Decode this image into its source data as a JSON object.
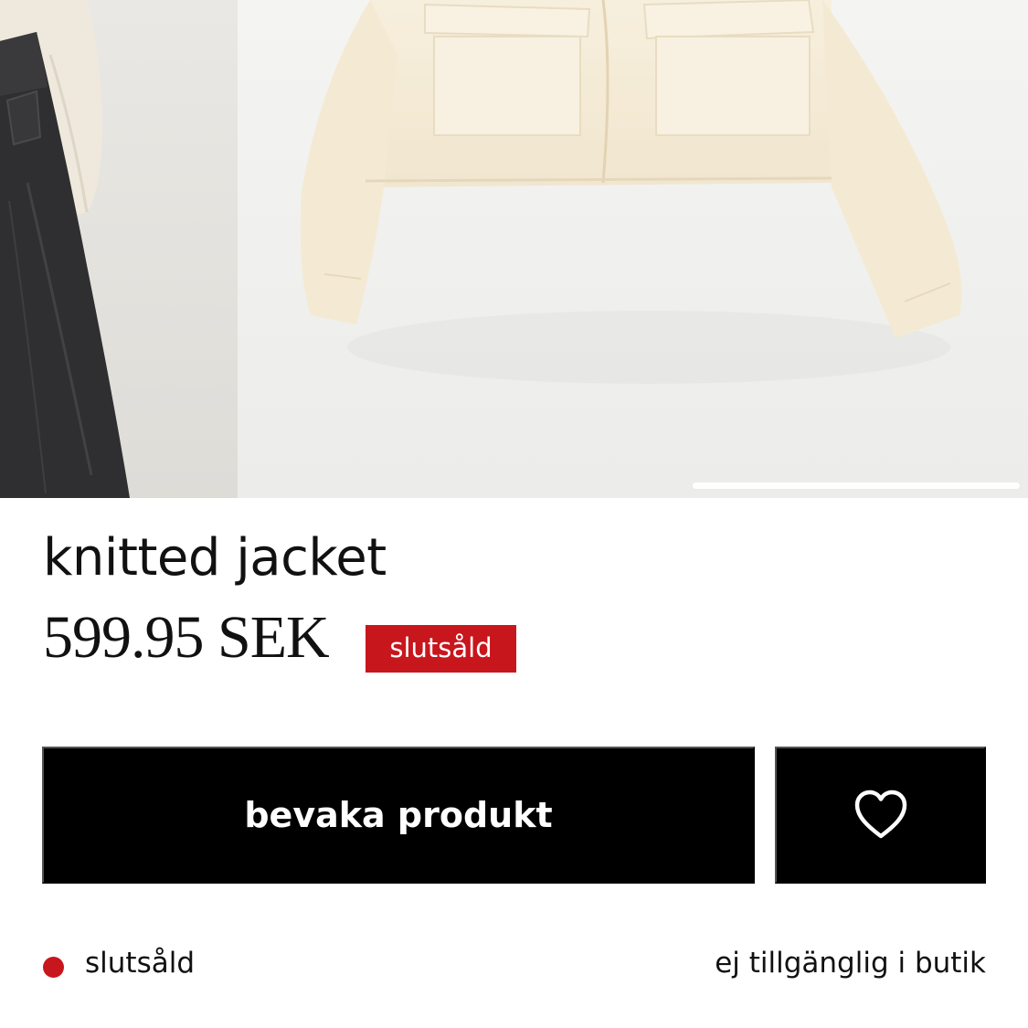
{
  "product": {
    "title": "knitted jacket",
    "price": "599.95 SEK",
    "badge": "slutsåld"
  },
  "actions": {
    "watch_label": "bevaka produkt",
    "favorite_icon": "heart-icon"
  },
  "availability": {
    "status": "slutsåld",
    "store": "ej tillgänglig i butik"
  },
  "colors": {
    "accent_red": "#c8161d",
    "button_bg": "#000000",
    "button_text": "#ffffff"
  }
}
